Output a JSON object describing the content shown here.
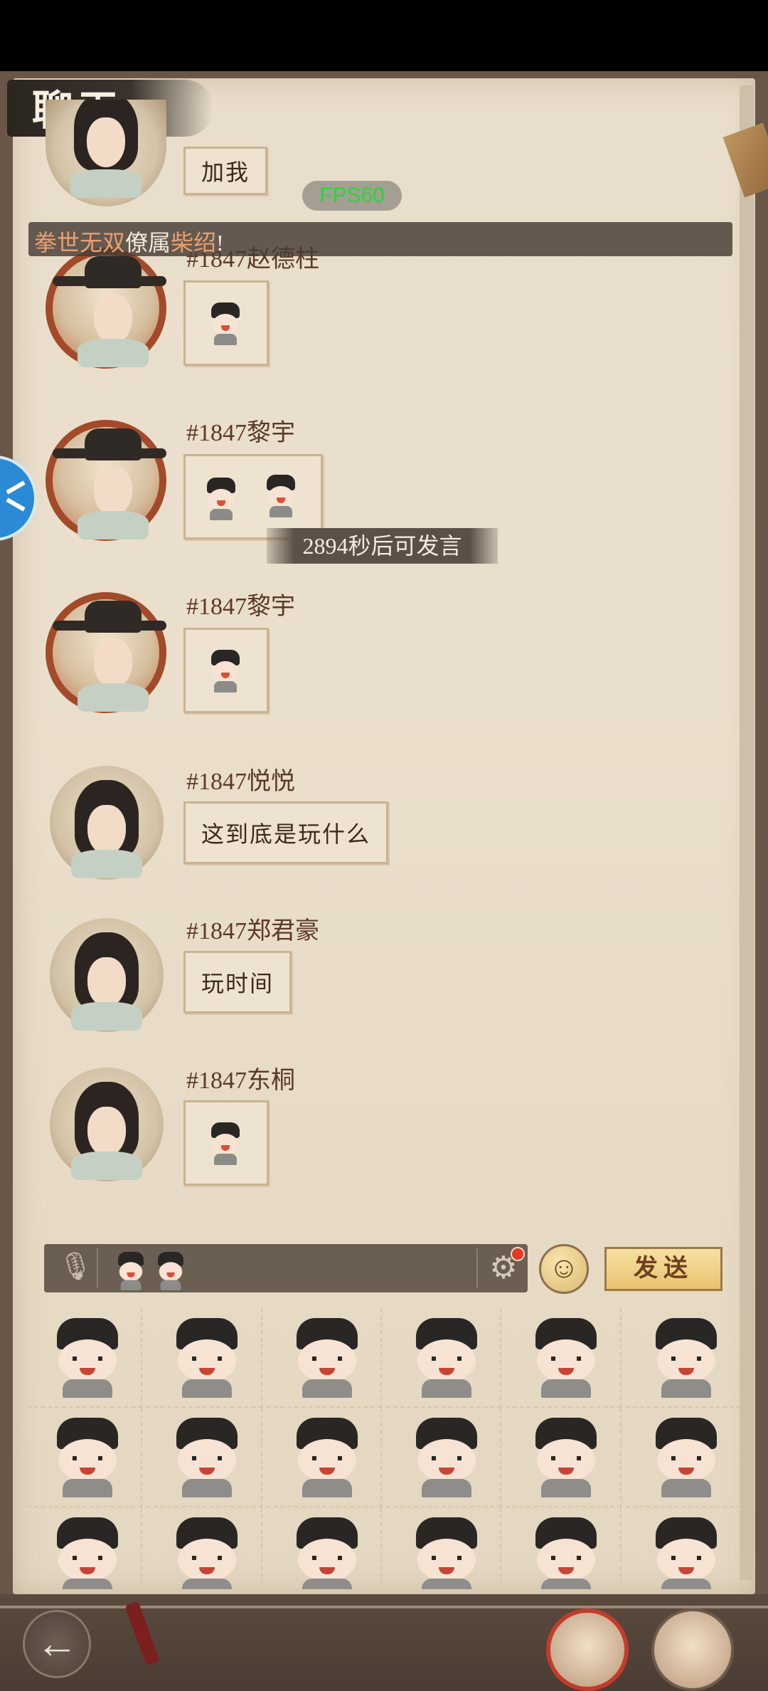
{
  "header": {
    "title": "聊天"
  },
  "overlays": {
    "fps": "FPS60",
    "broadcast": {
      "part1": "拳世无双",
      "part2": "僚属",
      "part3": "柴绍",
      "part4": "!"
    },
    "cooldown": "2894秒后可发言"
  },
  "messages": [
    {
      "name": "",
      "text": "加我",
      "type": "text",
      "avatar": "long-hair-man"
    },
    {
      "name": "#1847赵德柱",
      "text": "",
      "type": "emoji",
      "emojis": 1,
      "avatar": "official-ring"
    },
    {
      "name": "#1847黎宇",
      "text": "",
      "type": "emoji",
      "emojis": 2,
      "avatar": "official-ring"
    },
    {
      "name": "#1847黎宇",
      "text": "",
      "type": "emoji",
      "emojis": 1,
      "avatar": "official-ring"
    },
    {
      "name": "#1847悦悦",
      "text": "这到底是玩什么",
      "type": "text",
      "avatar": "long-hair-woman"
    },
    {
      "name": "#1847郑君豪",
      "text": "玩时间",
      "type": "text",
      "avatar": "long-hair-man"
    },
    {
      "name": "#1847东桐",
      "text": "",
      "type": "emoji",
      "emojis": 1,
      "avatar": "long-hair-woman"
    }
  ],
  "input": {
    "mic_icon": "microphone-icon",
    "settings_icon": "gear-icon",
    "emoji_toggle_icon": "smiley-icon",
    "send_label": "发送"
  },
  "emoji_panel": {
    "items": [
      "laughing",
      "covering-mouth",
      "confused",
      "nosebleed",
      "crying-tissue",
      "pointing-up",
      "eating",
      "pouting",
      "angry",
      "sobbing",
      "thinking",
      "watermelon",
      "smiling",
      "fish-jump",
      "hugging-fish",
      "sleepy",
      "dizzy",
      "holding-fish"
    ]
  },
  "bottom_nav": {
    "back_icon": "back-arrow-icon",
    "tabs": [
      "chat-character-tab",
      "elder-character-tab"
    ]
  },
  "colors": {
    "paper": "#eadfcc",
    "name_text": "#5b3a28",
    "fps": "#27d63a",
    "broadcast_highlight": "#e8a06e",
    "send_button": "#f0d08a",
    "active_tab_ring": "#c23b2b"
  }
}
